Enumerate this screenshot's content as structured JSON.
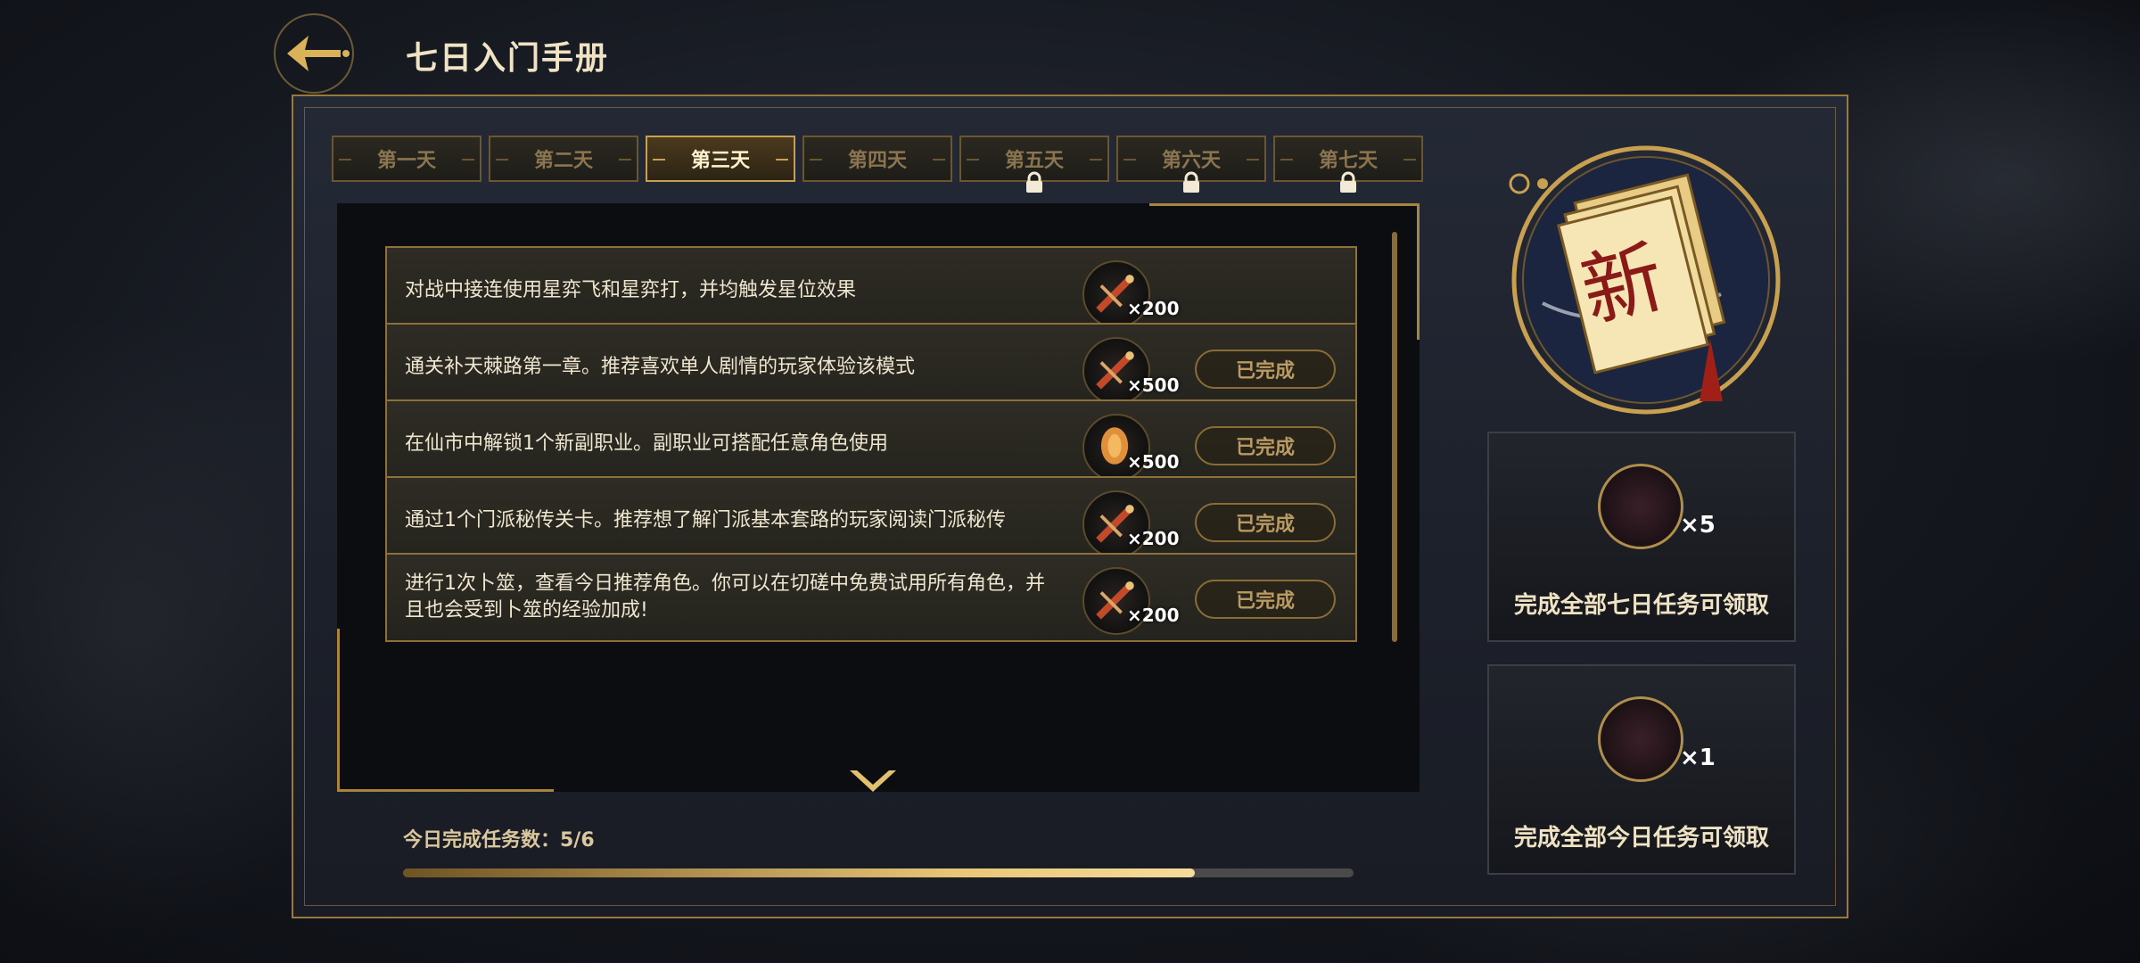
{
  "header": {
    "title": "七日入门手册"
  },
  "tabs": [
    {
      "label": "第一天",
      "locked": false,
      "active": false
    },
    {
      "label": "第二天",
      "locked": false,
      "active": false
    },
    {
      "label": "第三天",
      "locked": false,
      "active": true
    },
    {
      "label": "第四天",
      "locked": false,
      "active": false
    },
    {
      "label": "第五天",
      "locked": true,
      "active": false
    },
    {
      "label": "第六天",
      "locked": true,
      "active": false
    },
    {
      "label": "第七天",
      "locked": true,
      "active": false
    }
  ],
  "tasks": [
    {
      "desc": "对战中接连使用星弈飞和星弈打，并均触发星位效果",
      "reward_icon": "sword-item-icon",
      "reward_qty": "×200",
      "status": ""
    },
    {
      "desc": "通关补天棘路第一章。推荐喜欢单人剧情的玩家体验该模式",
      "reward_icon": "sword-item-icon",
      "reward_qty": "×500",
      "status": "已完成"
    },
    {
      "desc": "在仙市中解锁1个新副职业。副职业可搭配任意角色使用",
      "reward_icon": "coin-item-icon",
      "reward_qty": "×500",
      "status": "已完成"
    },
    {
      "desc": "通过1个门派秘传关卡。推荐想了解门派基本套路的玩家阅读门派秘传",
      "reward_icon": "sword-item-icon",
      "reward_qty": "×200",
      "status": "已完成"
    },
    {
      "desc": "进行1次卜筮，查看今日推荐角色。你可以在切磋中免费试用所有角色，并且也会受到卜筮的经验加成!",
      "reward_icon": "sword-item-icon",
      "reward_qty": "×200",
      "status": "已完成"
    }
  ],
  "progress": {
    "label": "今日完成任务数：5/6",
    "done": 5,
    "total": 6
  },
  "rewards": [
    {
      "qty": "×5",
      "condition": "完成全部七日任务可领取",
      "icon": "dragon-badge-icon"
    },
    {
      "qty": "×1",
      "condition": "完成全部今日任务可领取",
      "icon": "dragon-badge-icon"
    }
  ],
  "emblem": {
    "char": "新"
  },
  "colors": {
    "gold": "#c9a050",
    "progress_fill": "#e8c677"
  }
}
